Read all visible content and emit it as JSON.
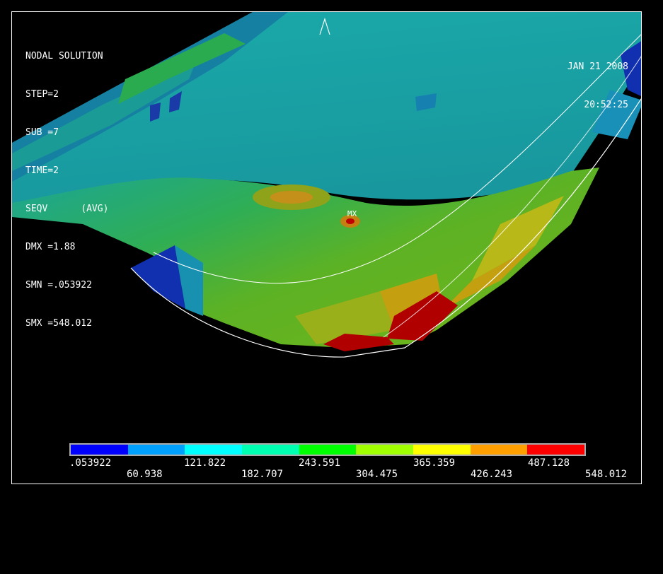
{
  "info": {
    "lines": [
      "NODAL SOLUTION",
      "STEP=2",
      "SUB =7",
      "TIME=2",
      "SEQV      (AVG)",
      "DMX =1.88",
      "SMN =.053922",
      "SMX =548.012"
    ]
  },
  "datetime": {
    "date": "JAN 21 2008",
    "time": "20:52:25"
  },
  "mx_marker": "MX",
  "legend": {
    "colors": [
      "#0000ff",
      "#00a0ff",
      "#00ffff",
      "#00ffb0",
      "#00ff00",
      "#a0ff00",
      "#ffff00",
      "#ffa000",
      "#ff0000"
    ],
    "top_labels": [
      ".053922",
      "121.822",
      "243.591",
      "365.359",
      "487.128"
    ],
    "bottom_labels": [
      "60.938",
      "182.707",
      "304.475",
      "426.243",
      "548.012"
    ]
  },
  "colors": {
    "background": "#000000",
    "frame": "#ffffff",
    "shell_base": "#1ba6a8",
    "shell_dark": "#127d9c",
    "shell_hot": "#c00000"
  }
}
